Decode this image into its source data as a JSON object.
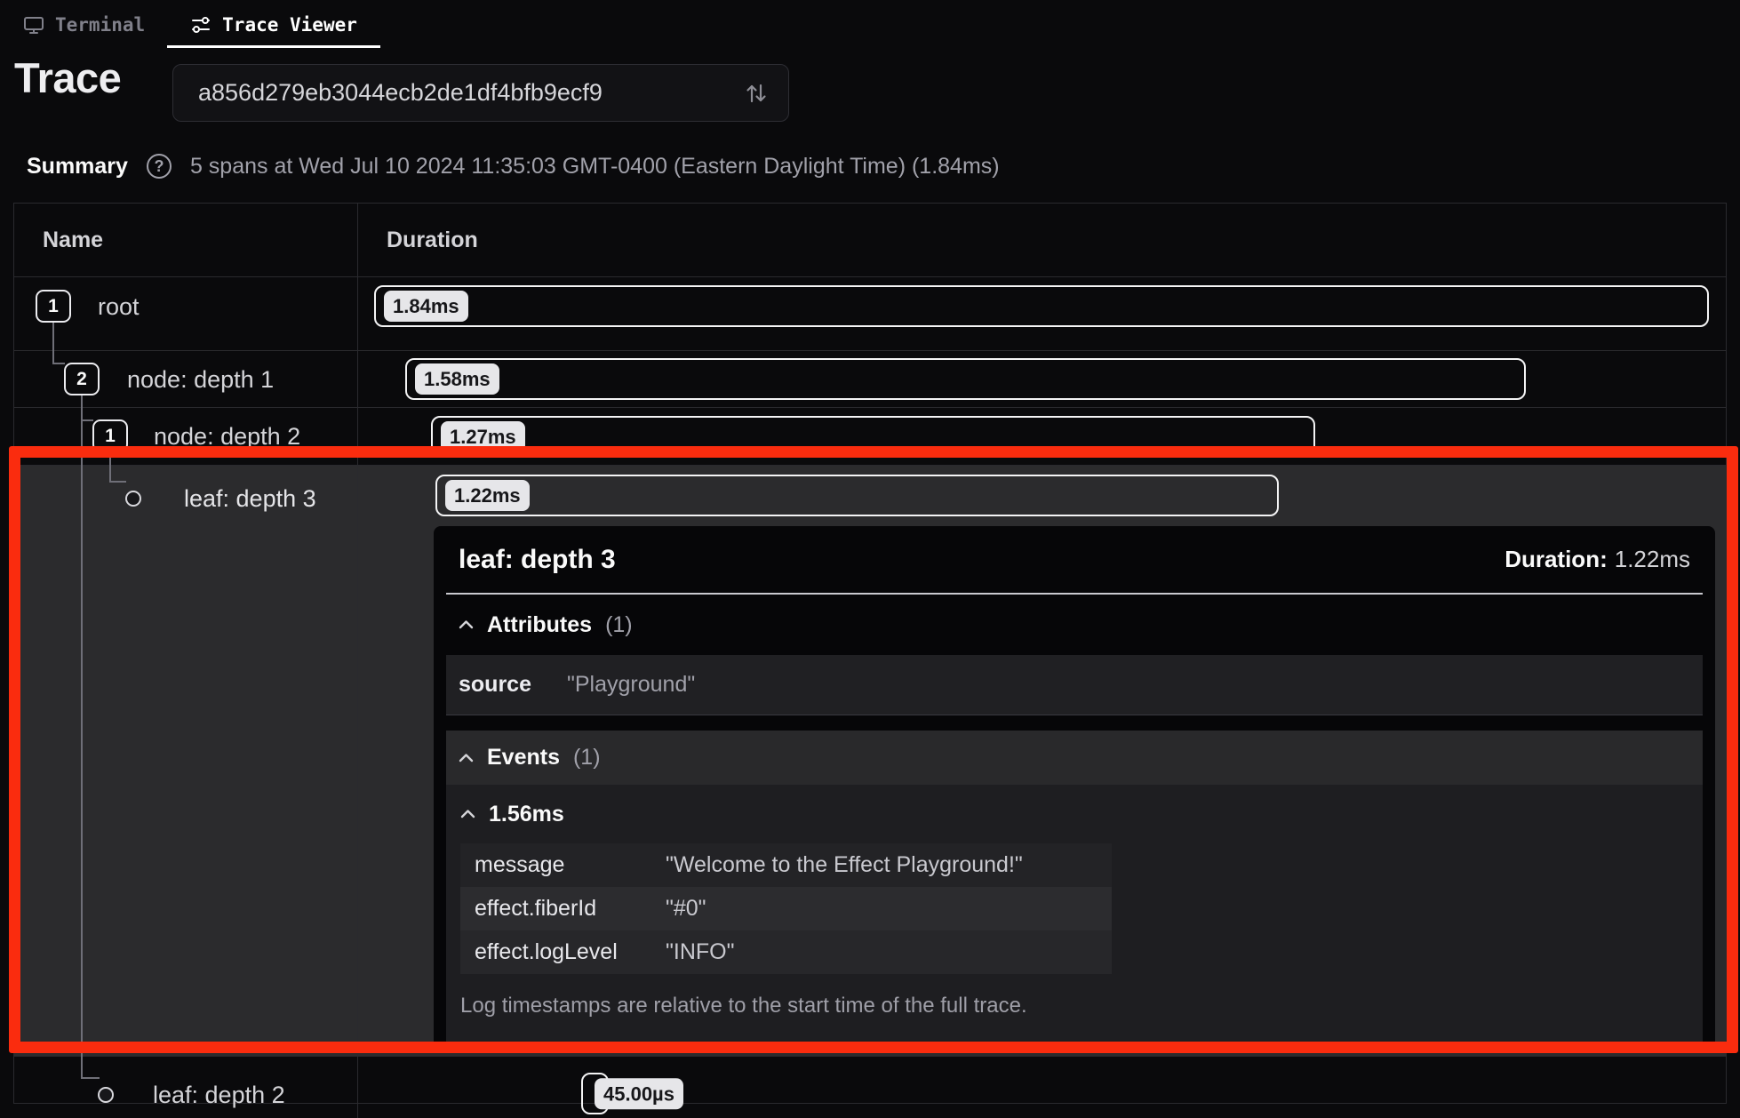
{
  "tabs": [
    {
      "label": "Terminal",
      "icon": "monitor-icon",
      "active": false
    },
    {
      "label": "Trace Viewer",
      "icon": "sliders-icon",
      "active": true
    }
  ],
  "header": {
    "title": "Trace",
    "trace_select": {
      "value": "a856d279eb3044ecb2de1df4bfb9ecf9",
      "icon": "up-down-arrows-icon"
    }
  },
  "summary": {
    "label": "Summary",
    "help_icon": "help-circle-icon",
    "text": "5 spans at Wed Jul 10 2024 11:35:03 GMT-0400 (Eastern Daylight Time) (1.84ms)"
  },
  "table": {
    "columns": [
      "Name",
      "Duration"
    ],
    "rows": [
      {
        "badge": "1",
        "label": "root",
        "duration": "1.84ms",
        "selected": false
      },
      {
        "badge": "2",
        "label": "node: depth 1",
        "duration": "1.58ms",
        "selected": false
      },
      {
        "badge": "1",
        "label": "node: depth 2",
        "duration": "1.27ms",
        "selected": false
      },
      {
        "badge": null,
        "label": "leaf: depth 3",
        "duration": "1.22ms",
        "selected": true
      },
      {
        "badge": null,
        "label": "leaf: depth 2",
        "duration": "45.00µs",
        "selected": false
      }
    ]
  },
  "detail_panel": {
    "title": "leaf: depth 3",
    "duration_label": "Duration:",
    "duration_value": "1.22ms",
    "attributes": {
      "title": "Attributes",
      "count": "(1)",
      "chevron_icon": "chevron-up-icon",
      "rows": [
        {
          "key": "source",
          "value": "\"Playground\""
        }
      ]
    },
    "events": {
      "title": "Events",
      "count": "(1)",
      "chevron_icon": "chevron-up-icon",
      "event_time": "1.56ms",
      "rows": [
        {
          "key": "message",
          "value": "\"Welcome to the Effect Playground!\""
        },
        {
          "key": "effect.fiberId",
          "value": "\"#0\""
        },
        {
          "key": "effect.logLevel",
          "value": "\"INFO\""
        }
      ],
      "note": "Log timestamps are relative to the start time of the full trace."
    }
  },
  "annotation": {
    "color": "#fa2c0e"
  }
}
